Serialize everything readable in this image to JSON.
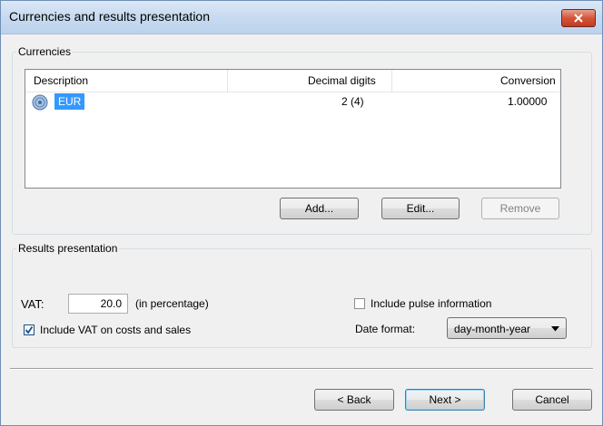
{
  "window": {
    "title": "Currencies and results presentation"
  },
  "currencies": {
    "legend": "Currencies",
    "columns": [
      "Description",
      "Decimal digits",
      "Conversion"
    ],
    "rows": [
      {
        "description": "EUR",
        "decimal_digits": "2  (4)",
        "conversion": "1.00000"
      }
    ],
    "buttons": {
      "add": "Add...",
      "edit": "Edit...",
      "remove": "Remove"
    }
  },
  "results": {
    "legend": "Results presentation",
    "vat_label": "VAT:",
    "vat_value": "20.0",
    "vat_suffix": "(in percentage)",
    "include_pulse_label": "Include pulse information",
    "include_pulse_checked": false,
    "include_vat_label": "Include VAT on costs and sales",
    "include_vat_checked": true,
    "date_format_label": "Date format:",
    "date_format_value": "day-month-year"
  },
  "footer": {
    "back": "< Back",
    "next": "Next >",
    "cancel": "Cancel"
  },
  "colors": {
    "selection": "#3399ff",
    "close_button": "#c9452b",
    "titlebar": "#c7daf0"
  }
}
